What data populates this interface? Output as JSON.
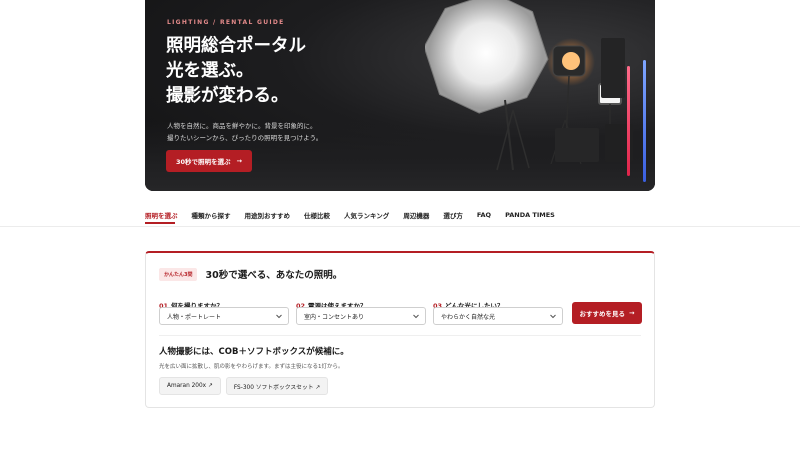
{
  "hero": {
    "eyebrow": "LIGHTING / RENTAL GUIDE",
    "title_lines": [
      "照明総合ポータル",
      "光を選ぶ。",
      "撮影が変わる。"
    ],
    "desc_lines": [
      "人物を自然に。商品を鮮やかに。背景を印象的に。",
      "撮りたいシーンから、ぴったりの照明を見つけよう。"
    ],
    "cta_label": "30秒で照明を選ぶ",
    "cta_arrow": "→"
  },
  "nav": {
    "items": [
      "照明を選ぶ",
      "種類から探す",
      "用途別おすすめ",
      "仕様比較",
      "人気ランキング",
      "周辺機器",
      "選び方",
      "FAQ",
      "PANDA TIMES"
    ]
  },
  "finder": {
    "badge": "かんたん3問",
    "title": "30秒で選べる、あなたの照明。",
    "questions": [
      {
        "num": "01",
        "label": "何を撮りますか？",
        "value": "人物・ポートレート"
      },
      {
        "num": "02",
        "label": "電源は使えますか？",
        "value": "室内・コンセントあり"
      },
      {
        "num": "03",
        "label": "どんな光にしたい？",
        "value": "やわらかく自然な光"
      }
    ],
    "submit_label": "おすすめを見る",
    "submit_arrow": "→",
    "result_title": "人物撮影には、COB＋ソフトボックスが候補に。",
    "result_desc": "光を広い面に拡散し、肌の影をやわらげます。まずは主役になる1灯から。",
    "chips": [
      "Amaran 200x ↗",
      "FS-300 ソフトボックスセット ↗"
    ]
  },
  "colors": {
    "accent": "#b41e24",
    "hero_bg": "#1d1d1f"
  }
}
